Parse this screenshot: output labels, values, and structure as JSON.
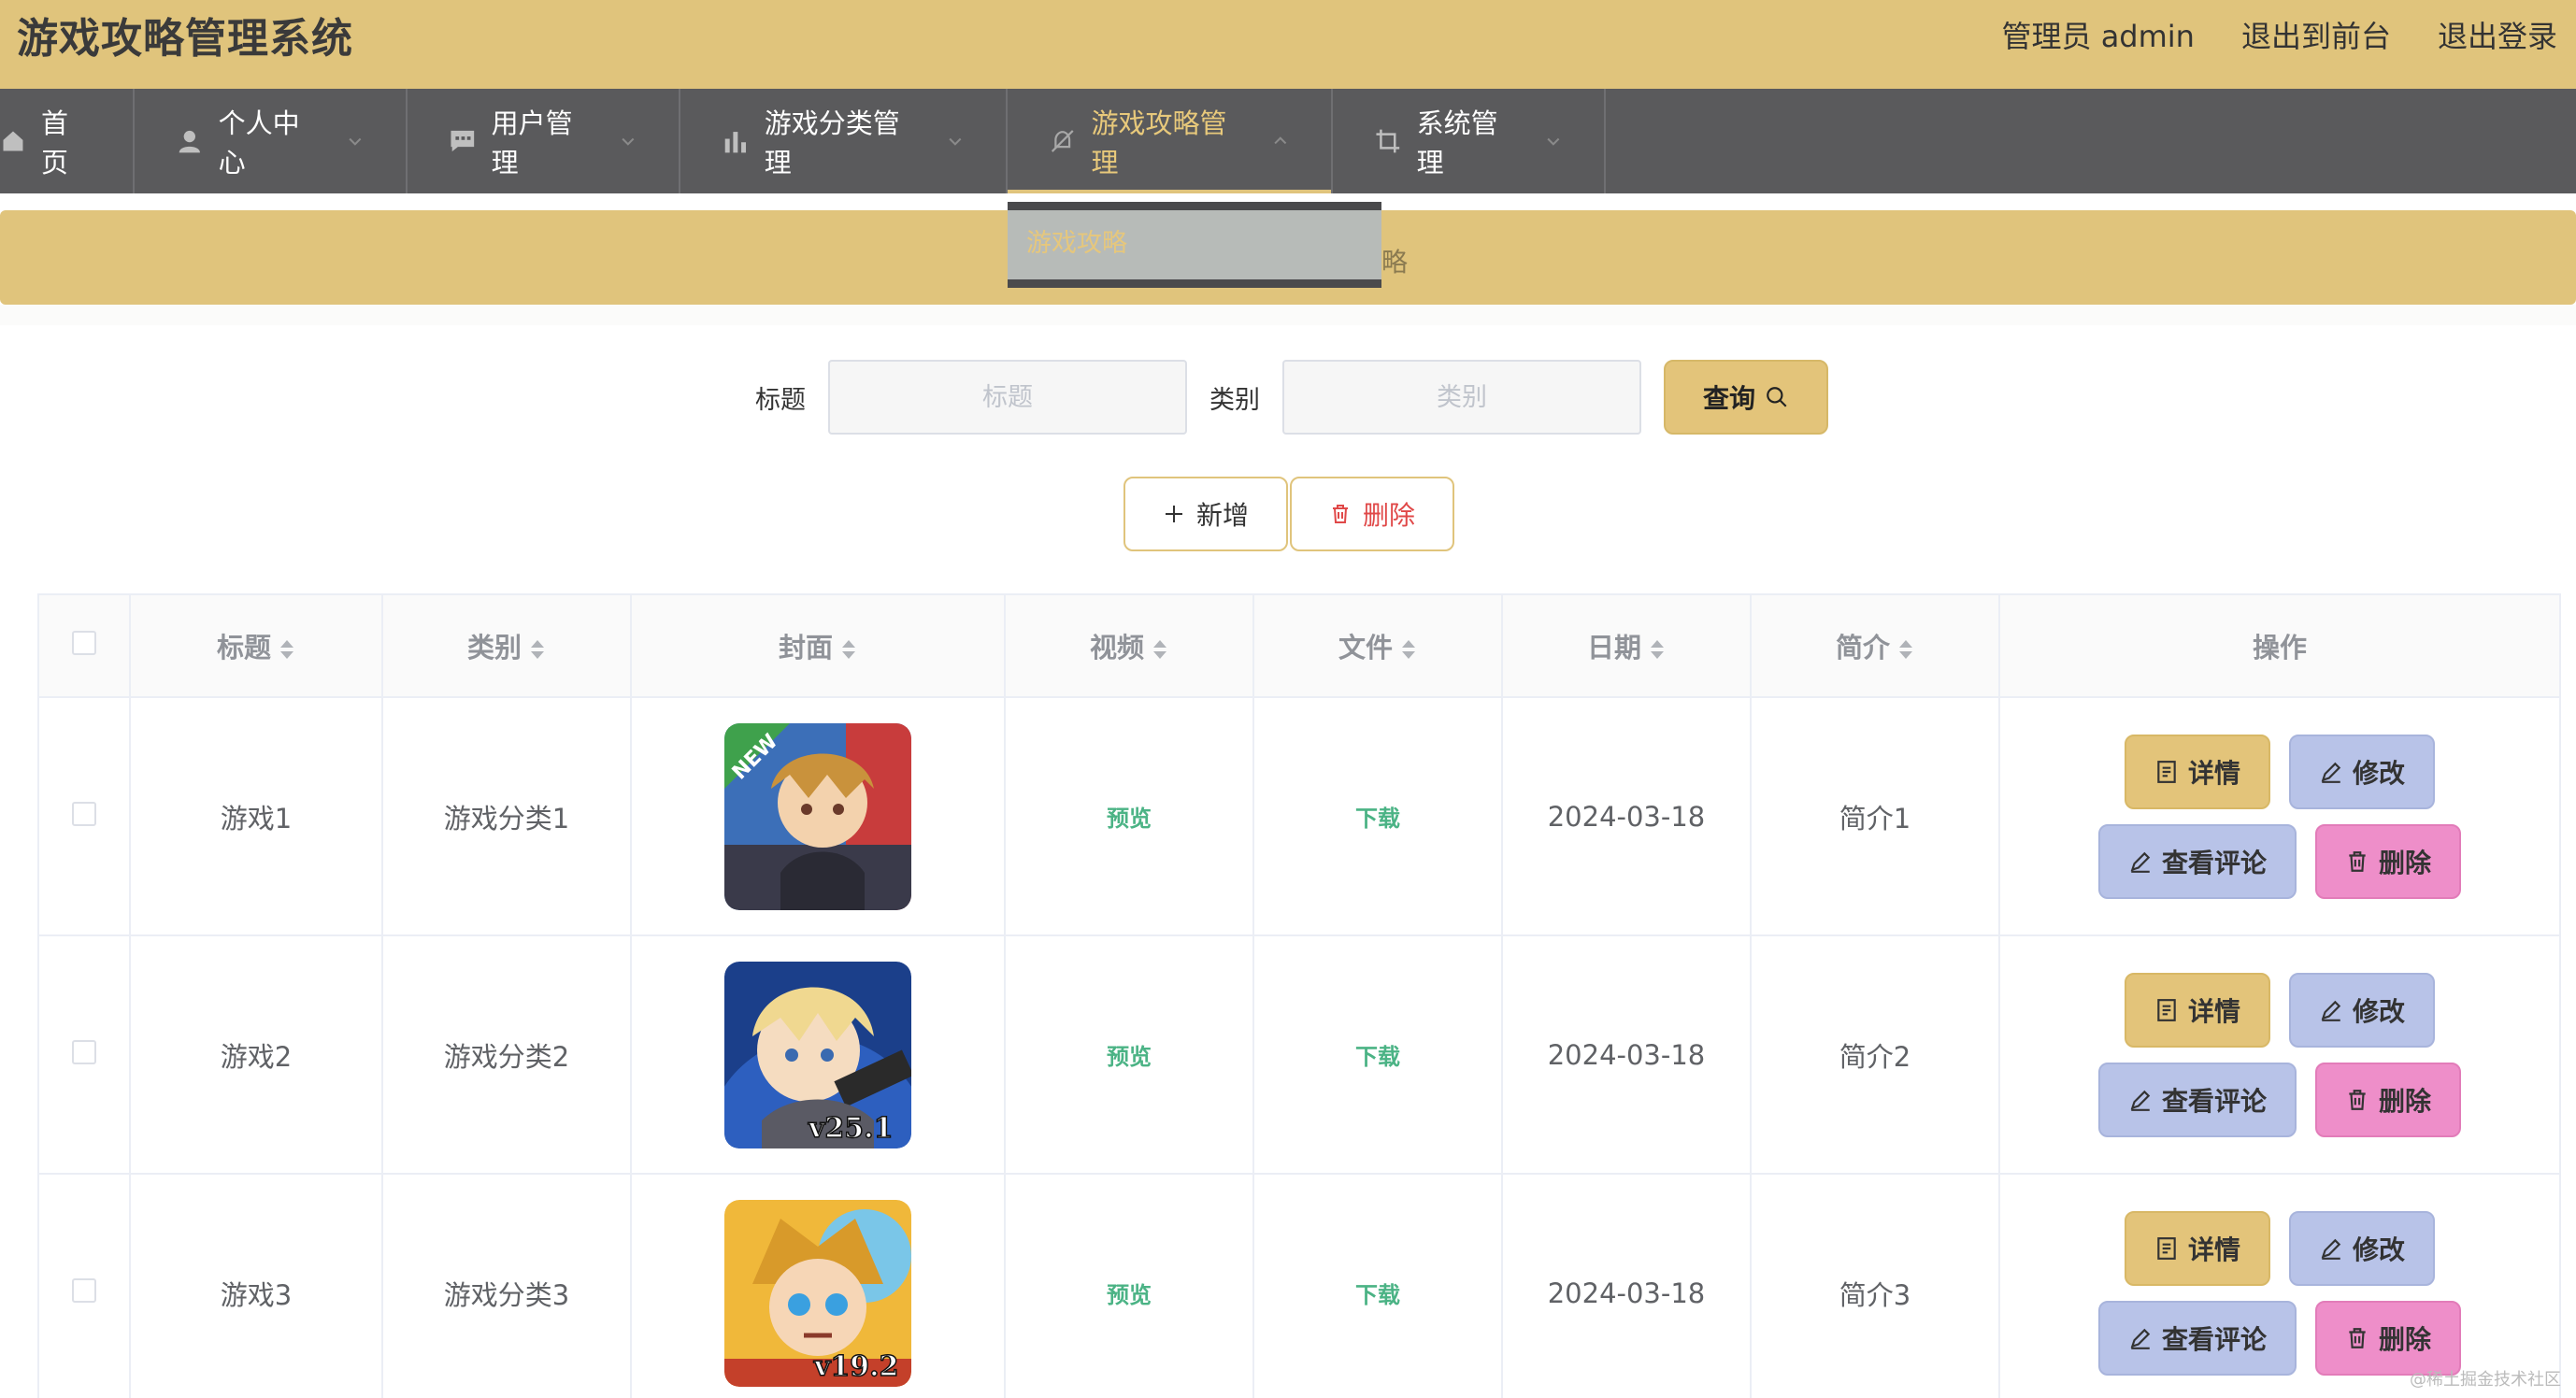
{
  "header": {
    "title": "游戏攻略管理系统",
    "admin_label": "管理员 admin",
    "to_front": "退出到前台",
    "logout": "退出登录"
  },
  "nav": {
    "items": [
      {
        "label": "首页",
        "icon": "home-icon"
      },
      {
        "label": "个人中心",
        "icon": "user-icon"
      },
      {
        "label": "用户管理",
        "icon": "chat-icon"
      },
      {
        "label": "游戏分类管理",
        "icon": "bar-chart-icon"
      },
      {
        "label": "游戏攻略管理",
        "icon": "bell-off-icon"
      },
      {
        "label": "系统管理",
        "icon": "crop-icon"
      }
    ],
    "dropdown_item": "游戏攻略",
    "breadcrumb_tail": "略"
  },
  "search": {
    "title_label": "标题",
    "title_placeholder": "标题",
    "category_label": "类别",
    "category_placeholder": "类别",
    "query_button": "查询"
  },
  "actions": {
    "add": "新增",
    "delete": "删除"
  },
  "table": {
    "headers": [
      "标题",
      "类别",
      "封面",
      "视频",
      "文件",
      "日期",
      "简介",
      "操作"
    ],
    "rows": [
      {
        "title": "游戏1",
        "category": "游戏分类1",
        "video": "预览",
        "file": "下载",
        "date": "2024-03-18",
        "intro": "简介1",
        "cover_badge": "NEW"
      },
      {
        "title": "游戏2",
        "category": "游戏分类2",
        "video": "预览",
        "file": "下载",
        "date": "2024-03-18",
        "intro": "简介2",
        "cover_badge": "v25.1"
      },
      {
        "title": "游戏3",
        "category": "游戏分类3",
        "video": "预览",
        "file": "下载",
        "date": "2024-03-18",
        "intro": "简介3",
        "cover_badge": "v19.2"
      }
    ],
    "ops": {
      "detail": "详情",
      "edit": "修改",
      "comment": "查看评论",
      "remove": "删除"
    }
  },
  "watermark": "@稀土掘金技术社区",
  "colors": {
    "header": "#e0c47c",
    "nav": "#5a5a5c",
    "active": "#e8c97b",
    "edit": "#b8c3e8",
    "remove": "#ee8ec9",
    "link": "#4bb385"
  }
}
